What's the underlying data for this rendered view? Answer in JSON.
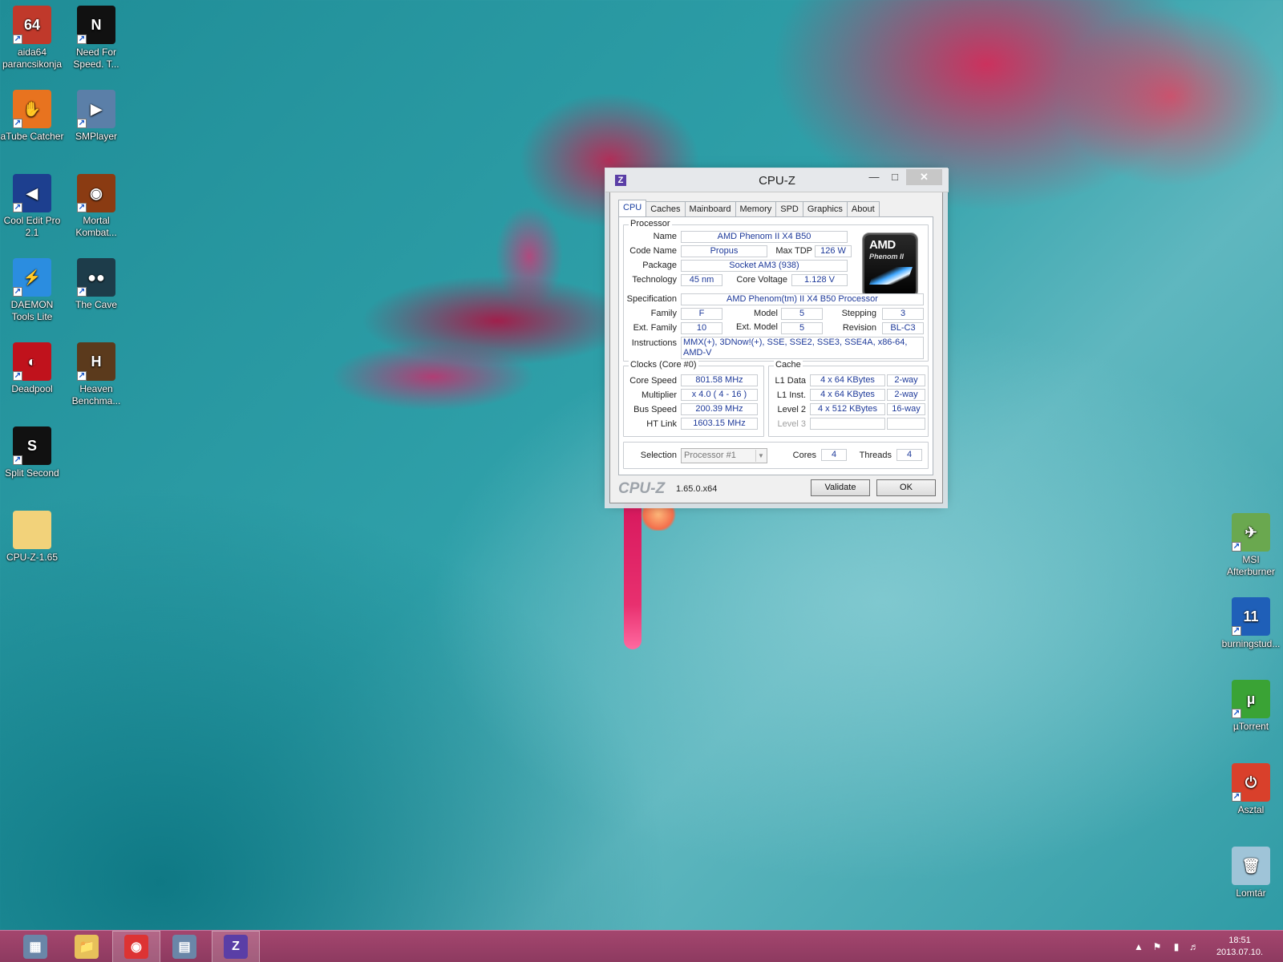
{
  "desktop": {
    "left_icons": [
      {
        "label": "aida64 parancsikonja",
        "icon": "aida64-icon",
        "glyph": "64",
        "color": "#c0392b"
      },
      {
        "label": "Need For Speed. T...",
        "icon": "nfs-icon",
        "glyph": "N",
        "color": "#111111"
      },
      {
        "label": "aTube Catcher",
        "icon": "atube-catcher-icon",
        "glyph": "✋",
        "color": "#e8731f"
      },
      {
        "label": "SMPlayer",
        "icon": "smplayer-icon",
        "glyph": "▶",
        "color": "#5b7fa8"
      },
      {
        "label": "Cool Edit Pro 2.1",
        "icon": "cool-edit-icon",
        "glyph": "◀",
        "color": "#1d3f8f"
      },
      {
        "label": "Mortal Kombat...",
        "icon": "mortal-kombat-icon",
        "glyph": "◉",
        "color": "#8a3b12"
      },
      {
        "label": "DAEMON Tools Lite",
        "icon": "daemon-tools-icon",
        "glyph": "⚡",
        "color": "#2b8de0"
      },
      {
        "label": "The Cave",
        "icon": "the-cave-icon",
        "glyph": "●●",
        "color": "#1d3c4a"
      },
      {
        "label": "Deadpool",
        "icon": "deadpool-icon",
        "glyph": "◐",
        "color": "#c0121c"
      },
      {
        "label": "Heaven Benchma...",
        "icon": "heaven-benchmark-icon",
        "glyph": "H",
        "color": "#5b3a1c"
      },
      {
        "label": "Split Second",
        "icon": "split-second-icon",
        "glyph": "S",
        "color": "#111111"
      },
      {
        "label": "CPU-Z-1.65",
        "icon": "folder-icon",
        "glyph": "",
        "color": "#f2d27a"
      }
    ],
    "right_icons": [
      {
        "label": "MSI Afterburner",
        "icon": "msi-afterburner-icon",
        "glyph": "✈",
        "color": "#6aa84f"
      },
      {
        "label": "burningstud...",
        "icon": "burningstudio-icon",
        "glyph": "11",
        "color": "#1f5fb8"
      },
      {
        "label": "µTorrent",
        "icon": "utorrent-icon",
        "glyph": "µ",
        "color": "#3aa335"
      },
      {
        "label": "Asztal",
        "icon": "power-icon",
        "glyph": "⏻",
        "color": "#d9402b"
      },
      {
        "label": "Lomtár",
        "icon": "recycle-bin-icon",
        "glyph": "🗑",
        "color": "#9fc4d8"
      }
    ]
  },
  "cpuz": {
    "title": "CPU-Z",
    "tabs": [
      "CPU",
      "Caches",
      "Mainboard",
      "Memory",
      "SPD",
      "Graphics",
      "About"
    ],
    "active_tab": "CPU",
    "processor": {
      "legend": "Processor",
      "name_label": "Name",
      "name": "AMD Phenom II X4 B50",
      "codename_label": "Code Name",
      "codename": "Propus",
      "maxtdp_label": "Max TDP",
      "maxtdp": "126 W",
      "package_label": "Package",
      "package": "Socket AM3 (938)",
      "technology_label": "Technology",
      "technology": "45 nm",
      "corevoltage_label": "Core Voltage",
      "corevoltage": "1.128 V",
      "specification_label": "Specification",
      "specification": "AMD Phenom(tm) II X4 B50 Processor",
      "family_label": "Family",
      "family": "F",
      "model_label": "Model",
      "model": "5",
      "stepping_label": "Stepping",
      "stepping": "3",
      "extfamily_label": "Ext. Family",
      "extfamily": "10",
      "extmodel_label": "Ext. Model",
      "extmodel": "5",
      "revision_label": "Revision",
      "revision": "BL-C3",
      "instructions_label": "Instructions",
      "instructions": "MMX(+), 3DNow!(+), SSE, SSE2, SSE3, SSE4A, x86-64, AMD-V",
      "logo_brand": "AMD",
      "logo_line": "Phenom II"
    },
    "clocks": {
      "legend": "Clocks (Core #0)",
      "corespeed_label": "Core Speed",
      "corespeed": "801.58 MHz",
      "multiplier_label": "Multiplier",
      "multiplier": "x 4.0 ( 4 - 16 )",
      "busspeed_label": "Bus Speed",
      "busspeed": "200.39 MHz",
      "htlink_label": "HT Link",
      "htlink": "1603.15 MHz"
    },
    "cache": {
      "legend": "Cache",
      "l1data_label": "L1 Data",
      "l1data": "4 x 64 KBytes",
      "l1data_way": "2-way",
      "l1inst_label": "L1 Inst.",
      "l1inst": "4 x 64 KBytes",
      "l1inst_way": "2-way",
      "level2_label": "Level 2",
      "level2": "4 x 512 KBytes",
      "level2_way": "16-way",
      "level3_label": "Level 3",
      "level3": "",
      "level3_way": ""
    },
    "selection": {
      "label": "Selection",
      "value": "Processor #1",
      "cores_label": "Cores",
      "cores": "4",
      "threads_label": "Threads",
      "threads": "4"
    },
    "footer": {
      "brand": "CPU-Z",
      "version": "1.65.0.x64",
      "validate_label": "Validate",
      "ok_label": "OK"
    }
  },
  "taskbar": {
    "items": [
      {
        "name": "server-manager-icon",
        "glyph": "▦"
      },
      {
        "name": "file-explorer-icon",
        "glyph": "📁"
      },
      {
        "name": "chrome-icon",
        "glyph": "◉"
      },
      {
        "name": "control-panel-icon",
        "glyph": "▤"
      },
      {
        "name": "cpuz-taskbar-icon",
        "glyph": "Z"
      }
    ],
    "clock_time": "18:51",
    "clock_date": "2013.07.10."
  }
}
